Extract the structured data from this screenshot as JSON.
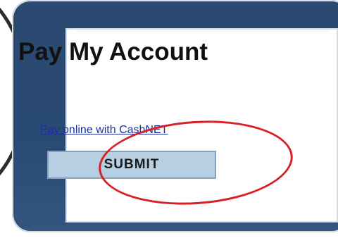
{
  "page": {
    "title": "Pay My Account",
    "cashnet_link": "Pay online with CashNET",
    "submit_label": "SUBMIT"
  },
  "colors": {
    "panel_background": "#2b4a72",
    "card_background": "#ffffff",
    "link": "#1a2f9a",
    "button_background": "#b7cfe3",
    "highlight_ellipse": "#d82027"
  },
  "icons": {
    "left_ring": "decorative-ring"
  }
}
